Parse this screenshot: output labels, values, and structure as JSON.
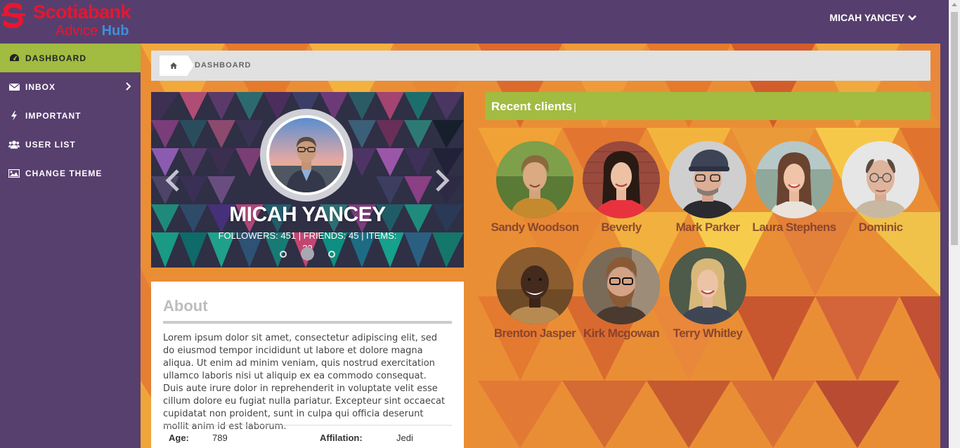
{
  "brand": {
    "line1": "Scotiabank",
    "line2a": "Advice",
    "line2b": "Hub"
  },
  "user_menu": {
    "label": "MICAH YANCEY"
  },
  "sidebar": {
    "items": [
      {
        "label": "DASHBOARD",
        "icon": "dashboard-icon",
        "active": true
      },
      {
        "label": "INBOX",
        "icon": "envelope-icon",
        "has_submenu": true
      },
      {
        "label": "IMPORTANT",
        "icon": "bolt-icon"
      },
      {
        "label": "USER LIST",
        "icon": "users-icon"
      },
      {
        "label": "CHANGE THEME",
        "icon": "picture-icon"
      }
    ]
  },
  "breadcrumb": {
    "home_icon": "home-icon",
    "current": "DASHBOARD"
  },
  "profile": {
    "name": "MICAH YANCEY",
    "stats": "FOLLOWERS: 451 | FRIENDS: 45 | ITEMS: 22",
    "active_slide": 2,
    "slide_count": 3
  },
  "about": {
    "title": "About",
    "text": "Lorem ipsum dolor sit amet, consectetur adipiscing elit, sed do eiusmod tempor incididunt ut labore et dolore magna aliqua. Ut enim ad minim veniam, quis nostrud exercitation ullamco laboris nisi ut aliquip ex ea commodo consequat. Duis aute irure dolor in reprehenderit in voluptate velit esse cillum dolore eu fugiat nulla pariatur. Excepteur sint occaecat cupidatat non proident, sunt in culpa qui officia deserunt mollit anim id est laborum.",
    "age_label": "Age:",
    "age_value": "789",
    "affiliation_label": "Affilation:",
    "affiliation_value": "Jedi"
  },
  "recent_clients": {
    "title": "Recent clients",
    "cursor": "|",
    "clients": [
      {
        "name": "Sandy Woodson"
      },
      {
        "name": "Beverly"
      },
      {
        "name": "Mark Parker"
      },
      {
        "name": "Laura Stephens"
      },
      {
        "name": "Dominic"
      },
      {
        "name": "Brenton Jasper"
      },
      {
        "name": "Kirk Mcgowan"
      },
      {
        "name": "Terry Whitley"
      }
    ]
  },
  "colors": {
    "header_bg": "#563f6e",
    "accent": "#a2bb41",
    "brand_red": "#e8162f",
    "brand_blue": "#3f8fd8"
  }
}
